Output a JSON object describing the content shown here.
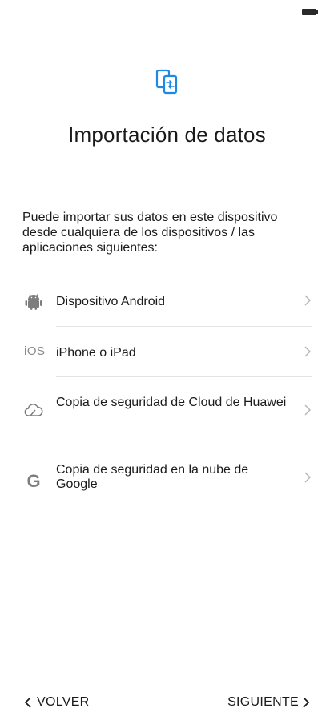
{
  "status_bar": {
    "battery_icon": "battery-icon"
  },
  "header": {
    "icon": "phone-transfer-icon",
    "title": "Importación de datos"
  },
  "description": "Puede importar sus datos en este dispositivo desde cualquiera de los dispositivos / las aplicaciones siguientes:",
  "options": [
    {
      "icon": "android-icon",
      "label": "Dispositivo Android"
    },
    {
      "icon": "ios-icon",
      "icon_text": "iOS",
      "label": "iPhone o iPad"
    },
    {
      "icon": "cloud-icon",
      "label": "Copia de seguridad de Cloud de Huawei"
    },
    {
      "icon": "google-icon",
      "icon_text": "G",
      "label": "Copia de seguridad en la nube de Google"
    }
  ],
  "footer": {
    "back_label": "VOLVER",
    "next_label": "SIGUIENTE"
  },
  "colors": {
    "accent": "#1e88e5",
    "text": "#1a1a1a",
    "muted": "#8a8a8a",
    "divider": "#e3e3e3"
  }
}
